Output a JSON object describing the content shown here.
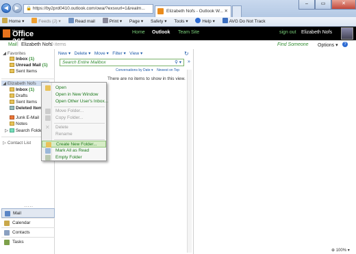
{
  "browser": {
    "address": "https://by2prd0410.outlook.com/owa/?exsvurl=1&realm...",
    "tabs": [
      {
        "label": "Elizabeth Nofs - Outlook W...",
        "active": true
      }
    ],
    "commands": [
      "Home",
      "Feeds (J)",
      "Read mail",
      "Print",
      "Page",
      "Safety",
      "Tools",
      "Help",
      "AVG Do Not Track"
    ]
  },
  "o365": {
    "logo_ms": "Microsoft",
    "logo_text": "Office 365",
    "nav": [
      "Home",
      "Outlook",
      "Team Site"
    ],
    "active_nav": "Outlook",
    "signout": "sign out",
    "user": "Elizabeth Nofs"
  },
  "subheader": {
    "app": "Mail",
    "mailbox": "Elizabeth Nofs",
    "count": "0 items",
    "find": "Find Someone",
    "options": "Options",
    "help": "?"
  },
  "leftnav": {
    "favorites_label": "Favorites",
    "favorites": [
      {
        "label": "Inbox",
        "count": "(1)",
        "bold": true
      },
      {
        "label": "Unread Mail",
        "count": "(1)",
        "bold": true
      },
      {
        "label": "Sent Items",
        "count": "",
        "bold": false
      }
    ],
    "account_label": "Elizabeth Nofs",
    "folders": [
      {
        "label": "Inbox",
        "count": "(1)",
        "bold": true
      },
      {
        "label": "Drafts",
        "count": "",
        "bold": false
      },
      {
        "label": "Sent Items",
        "count": "",
        "bold": false
      },
      {
        "label": "Deleted Items",
        "count": "(",
        "bold": true
      },
      {
        "label": "Junk E-Mail",
        "count": "",
        "bold": false
      },
      {
        "label": "Notes",
        "count": "",
        "bold": false
      },
      {
        "label": "Search Folders",
        "count": "",
        "bold": false
      }
    ],
    "contact_list": "Contact List",
    "bottom": [
      "Mail",
      "Calendar",
      "Contacts",
      "Tasks"
    ],
    "bottom_active": "Mail"
  },
  "listpane": {
    "toolbar": [
      "New",
      "Delete",
      "Move",
      "Filter",
      "View"
    ],
    "search_placeholder": "Search Entire Mailbox",
    "conversations_by": "Conversations by Date",
    "order": "Newest on Top",
    "empty": "There are no items to show in this view."
  },
  "context_menu": {
    "items": [
      {
        "label": "Open",
        "enabled": true,
        "icon": "open-icon"
      },
      {
        "label": "Open in New Window",
        "enabled": true,
        "icon": ""
      },
      {
        "label": "Open Other User's Inbox...",
        "enabled": true,
        "icon": ""
      },
      {
        "label": "Move Folder...",
        "enabled": false,
        "icon": "move-icon"
      },
      {
        "label": "Copy Folder...",
        "enabled": false,
        "icon": "copy-icon"
      },
      {
        "label": "Delete",
        "enabled": false,
        "icon": "delete-icon"
      },
      {
        "label": "Rename",
        "enabled": false,
        "icon": ""
      },
      {
        "label": "Create New Folder...",
        "enabled": true,
        "icon": "new-folder-icon",
        "highlighted": true
      },
      {
        "label": "Mark All as Read",
        "enabled": true,
        "icon": "mark-read-icon"
      },
      {
        "label": "Empty Folder",
        "enabled": true,
        "icon": "empty-folder-icon"
      }
    ]
  },
  "status": {
    "zoom": "100%"
  },
  "colors": {
    "accent_green": "#2f8a2f",
    "header_bg": "#000000",
    "link_blue": "#1d5aa8",
    "menu_highlight": "#d6ecc6"
  }
}
